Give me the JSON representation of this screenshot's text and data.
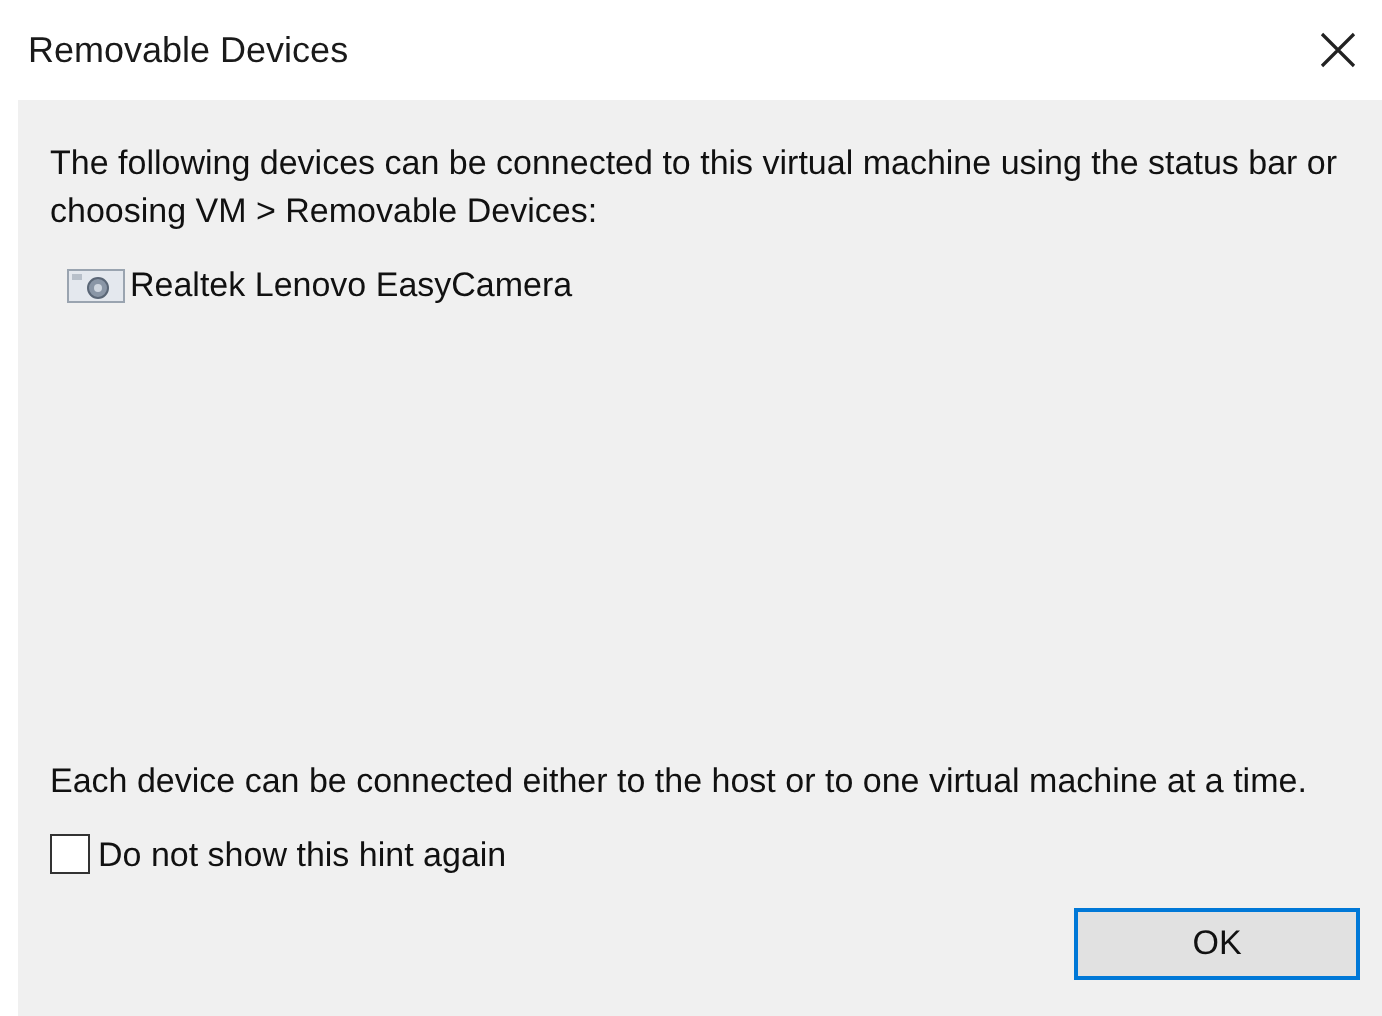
{
  "window": {
    "title": "Removable Devices"
  },
  "intro": "The following devices can be connected to this virtual machine using the status bar or choosing VM > Removable Devices:",
  "devices": [
    {
      "name": "Realtek Lenovo EasyCamera",
      "kind": "camera"
    }
  ],
  "note": "Each device can be connected either to the host or to one virtual machine at a time.",
  "hint_checkbox": {
    "label": "Do not show this hint again",
    "checked": false
  },
  "buttons": [
    {
      "label": "OK",
      "selected": true
    }
  ]
}
